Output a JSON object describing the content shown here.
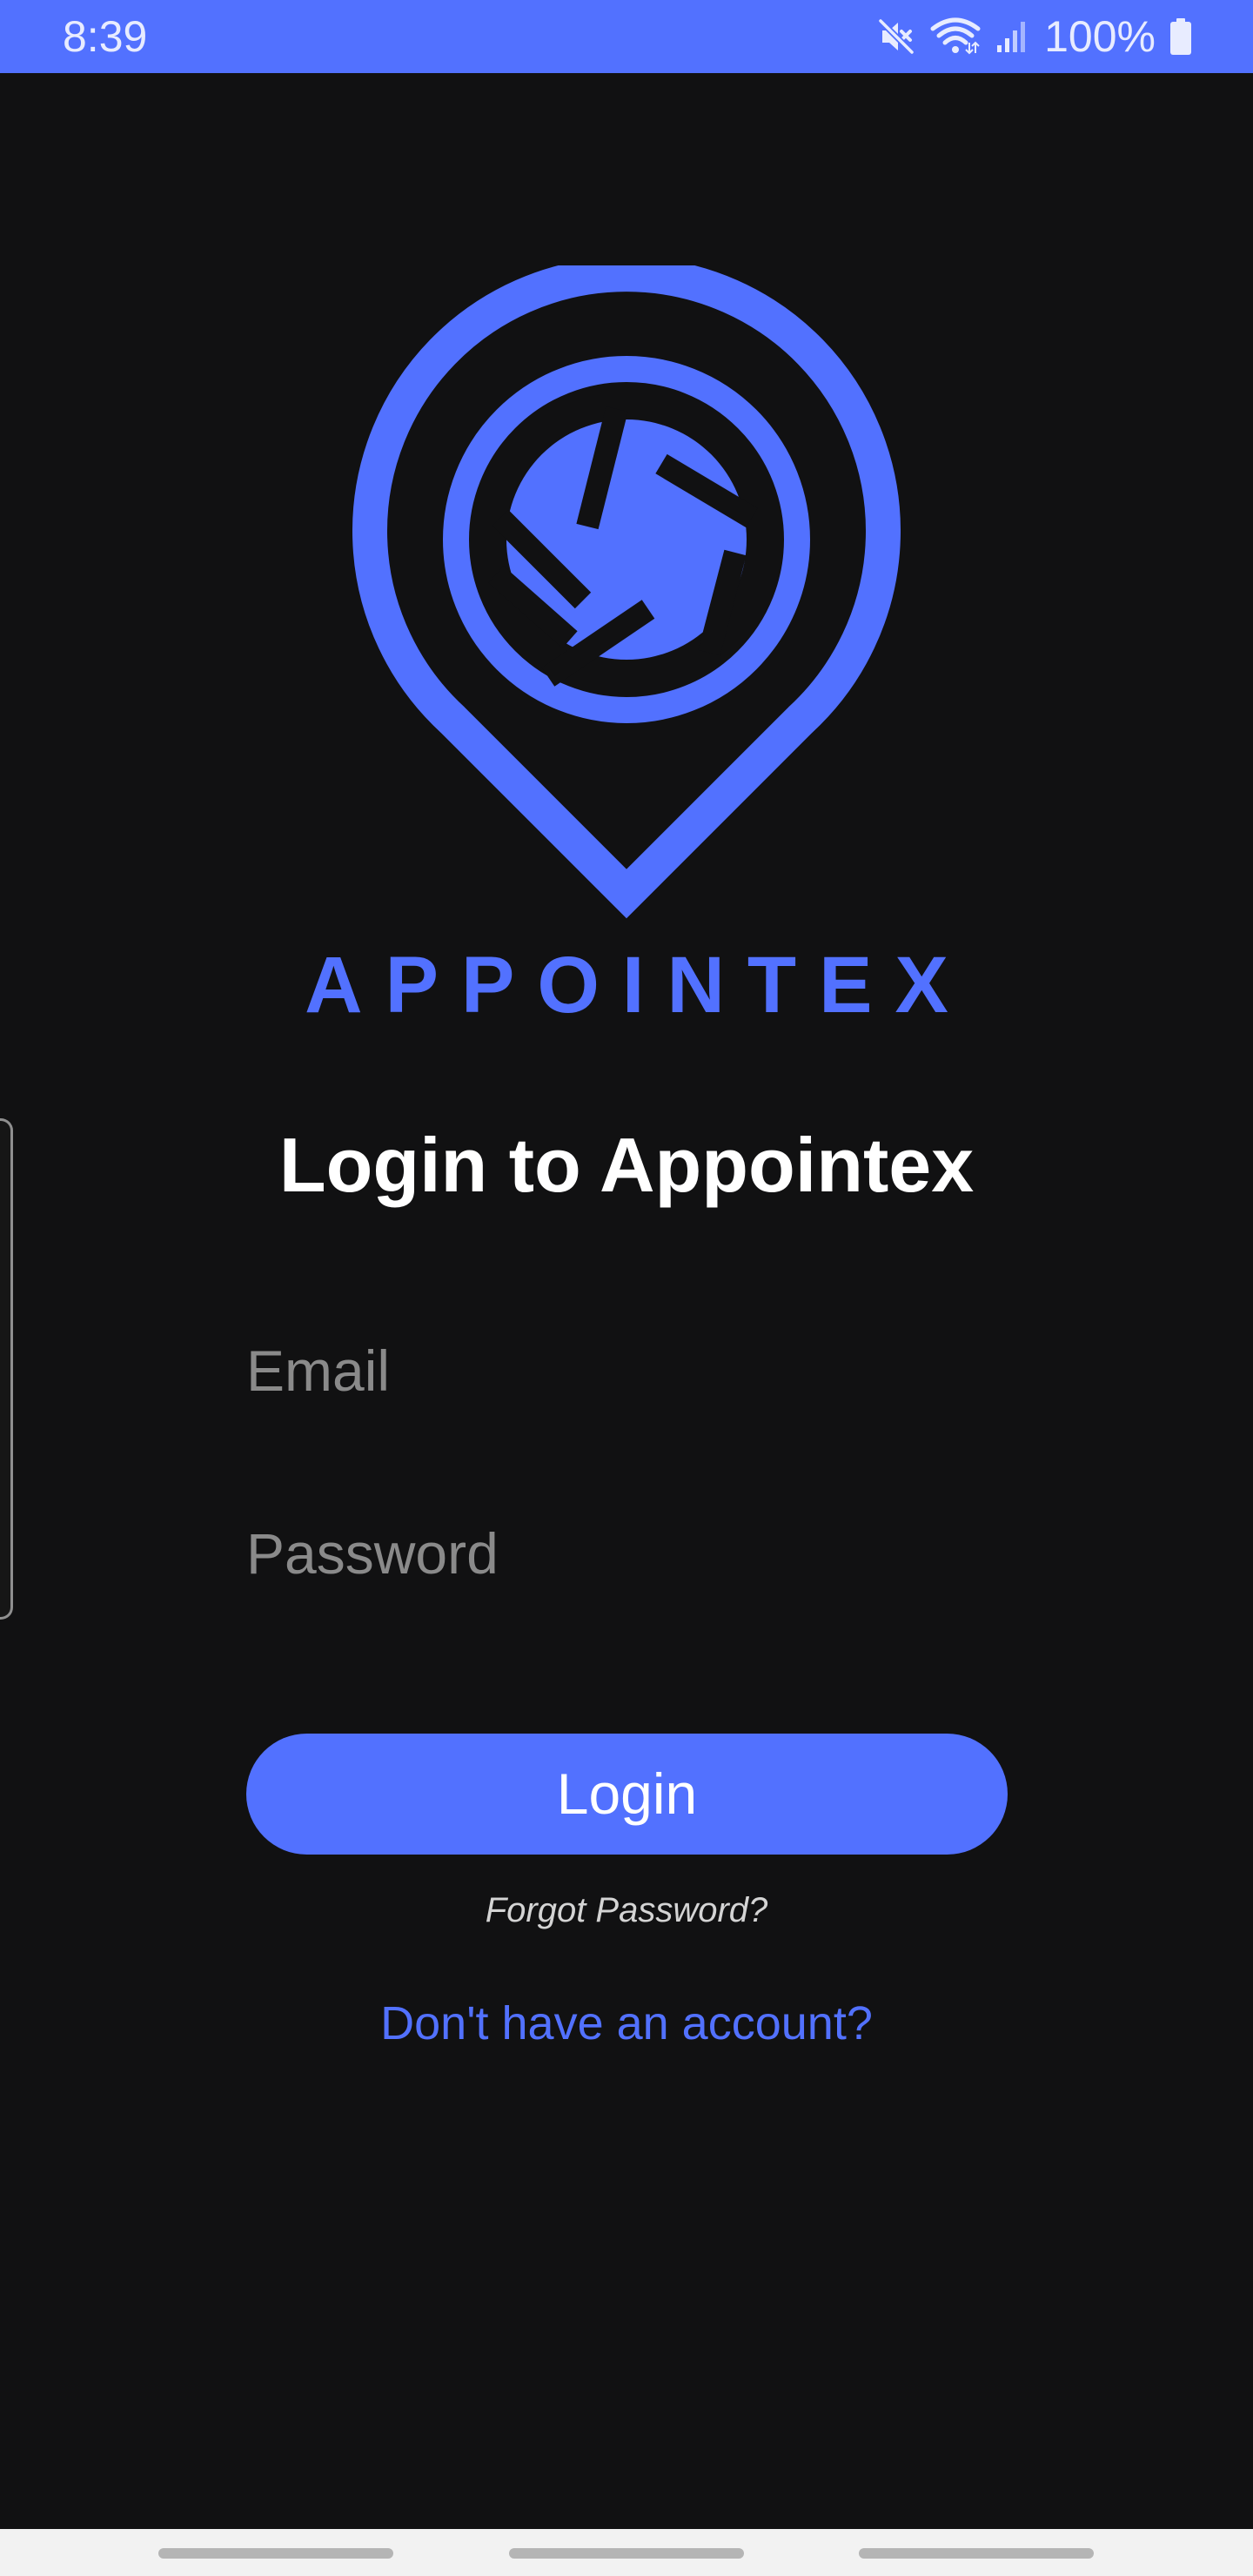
{
  "status_bar": {
    "time": "8:39",
    "battery_text": "100%",
    "icons": [
      "mute-icon",
      "wifi-icon",
      "signal-icon",
      "battery-icon"
    ]
  },
  "brand": {
    "name": "APPOINTEX",
    "logo_icon": "location-pin-camera-shutter-icon"
  },
  "login": {
    "title": "Login to Appointex",
    "email_placeholder": "Email",
    "email_value": "",
    "password_placeholder": "Password",
    "password_value": "",
    "button_label": "Login",
    "forgot_password": "Forgot Password?",
    "signup_link": "Don't have an account?"
  },
  "colors": {
    "accent": "#5271ff",
    "background": "#111112",
    "text_primary": "#ffffff",
    "placeholder": "#8a8a8a",
    "nav_bar": "#f2f2f2"
  }
}
